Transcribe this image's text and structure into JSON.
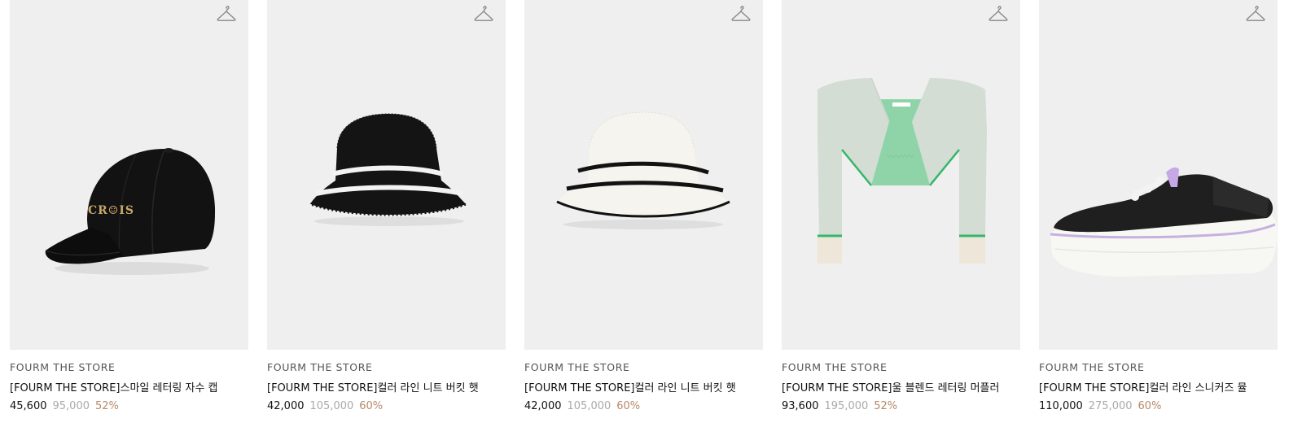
{
  "products": [
    {
      "brand": "FOURM THE STORE",
      "title": "[FOURM THE STORE]스마일 레터링 자수 캡",
      "price": "45,600",
      "original_price": "95,000",
      "discount": "52%",
      "image": "black-baseball-cap",
      "logo_text": "CR☺IS"
    },
    {
      "brand": "FOURM THE STORE",
      "title": "[FOURM THE STORE]컬러 라인 니트 버킷 햇",
      "price": "42,000",
      "original_price": "105,000",
      "discount": "60%",
      "image": "black-knit-bucket-hat"
    },
    {
      "brand": "FOURM THE STORE",
      "title": "[FOURM THE STORE]컬러 라인 니트 버킷 햇",
      "price": "42,000",
      "original_price": "105,000",
      "discount": "60%",
      "image": "white-knit-bucket-hat"
    },
    {
      "brand": "FOURM THE STORE",
      "title": "[FOURM THE STORE]울 블렌드 레터링 머플러",
      "price": "93,600",
      "original_price": "195,000",
      "discount": "52%",
      "image": "mint-wool-muffler"
    },
    {
      "brand": "FOURM THE STORE",
      "title": "[FOURM THE STORE]컬러 라인 스니커즈 뮬",
      "price": "110,000",
      "original_price": "275,000",
      "discount": "60%",
      "image": "black-sneaker-mule"
    }
  ],
  "colors": {
    "thumb_bg": "#efefef",
    "price": "#111111",
    "original_price": "#aaaaaa",
    "discount": "#b8896a"
  },
  "icons": {
    "wishlist": "hanger-icon"
  }
}
